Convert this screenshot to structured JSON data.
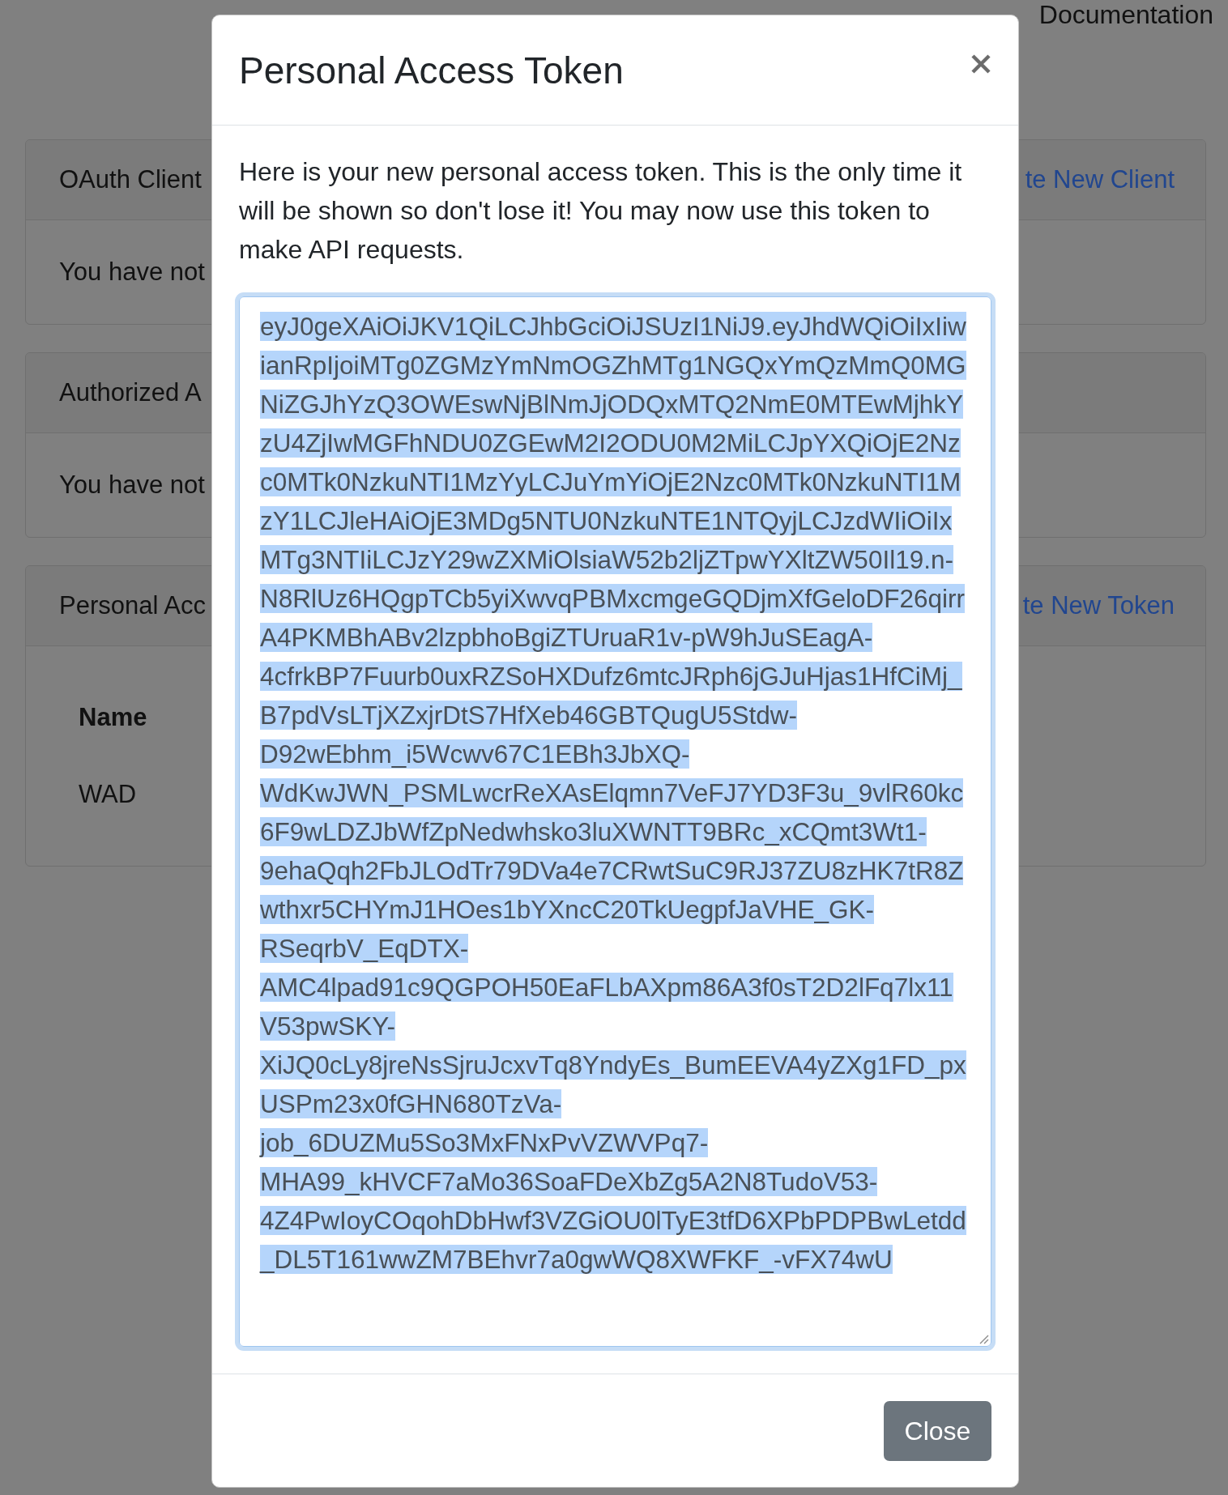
{
  "page": {
    "nav_link": "Documentation",
    "cards": [
      {
        "title": "OAuth Client",
        "action": "te New Client",
        "message": "You have not"
      },
      {
        "title": "Authorized A",
        "message": "You have not"
      },
      {
        "title": "Personal Acc",
        "action": "te New Token",
        "table": {
          "columns": [
            "Name"
          ],
          "rows": [
            [
              "WAD"
            ]
          ]
        }
      }
    ]
  },
  "modal": {
    "title": "Personal Access Token",
    "message": "Here is your new personal access token. This is the only time it will be shown so don't lose it! You may now use this token to make API requests.",
    "token_field": {
      "value": "eyJ0geXAiOiJKV1QiLCJhbGciOiJSUzI1NiJ9.eyJhdWQiOiIxIiwianRpIjoiMTg0ZGMzYmNmOGZhMTg1NGQxYmQzMmQ0MGNiZGJhYzQ3OWEswNjBlNmJjODQxMTQ2NmE0MTEwMjhkYzU4ZjIwMGFhNDU0ZGEwM2I2ODU0M2MiLCJpYXQiOjE2Nzc0MTk0NzkuNTI1MzYyLCJuYmYiOjE2Nzc0MTk0NzkuNTI1MzY1LCJleHAiOjE3MDg5NTU0NzkuNTE1NTQyjLCJzdWIiOiIxMTg3NTIiLCJzY29wZXMiOlsiaW52b2ljZTpwYXltZW50Il19.n-N8RlUz6HQgpTCb5yiXwvqPBMxcmgeGQDjmXfGeloDF26qirrA4PKMBhABv2lzpbhoBgiZTUruaR1v-pW9hJuSEagA-4cfrkBP7Fuurb0uxRZSoHXDufz6mtcJRph6jGJuHjas1HfCiMj_B7pdVsLTjXZxjrDtS7HfXeb46GBTQugU5Stdw-D92wEbhm_i5Wcwv67C1EBh3JbXQ-WdKwJWN_PSMLwcrReXAsElqmn7VeFJ7YD3F3u_9vlR60kc6F9wLDZJbWfZpNedwhsko3luXWNTT9BRc_xCQmt3Wt1-9ehaQqh2FbJLOdTr79DVa4e7CRwtSuC9RJ37ZU8zHK7tR8Zwthxr5CHYmJ1HOes1bYXncC20TkUegpfJaVHE_GK-RSeqrbV_EqDTX-AMC4lpad91c9QGPOH50EaFLbAXpm86A3f0sT2D2lFq7lx11V53pwSKY-XiJQ0cLy8jreNsSjruJcxvTq8YndyEs_BumEEVA4yZXg1FD_pxUSPm23x0fGHN680TzVa-job_6DUZMu5So3MxFNxPvVZWVPq7-MHA99_kHVCF7aMo36SoaFDeXbZg5A2N8TudoV53-4Z4PwIoyCOqohDbHwf3VZGiOU0lTyE3tfD6XPbPDPBwLetdd_DL5T161wwZM7BEhvr7a0gwWQ8XWFKF_-vFX74wU",
      "focused": true,
      "text_selected": true
    },
    "buttons": [
      {
        "label": "Close"
      }
    ]
  }
}
